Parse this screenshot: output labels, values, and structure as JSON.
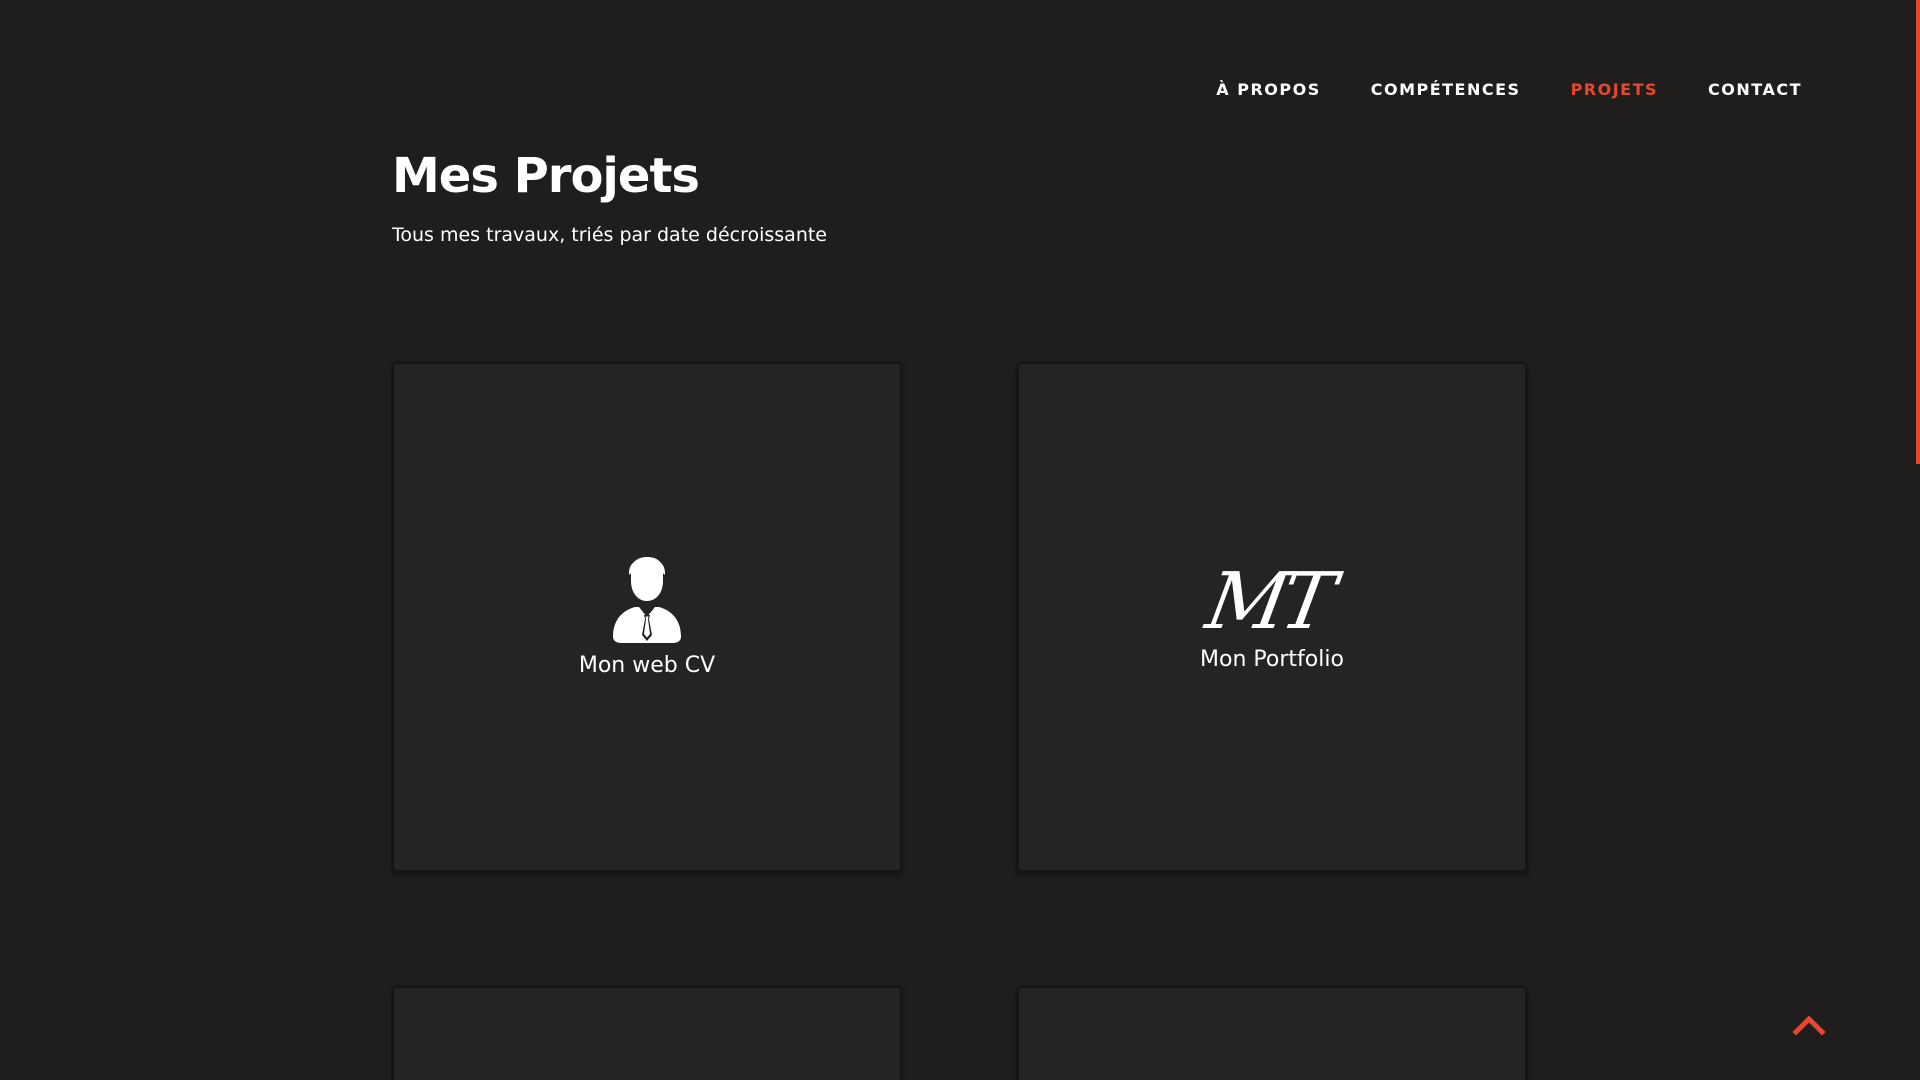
{
  "nav": {
    "items": [
      {
        "label": "À PROPOS"
      },
      {
        "label": "COMPÉTENCES"
      },
      {
        "label": "PROJETS",
        "active": true
      },
      {
        "label": "CONTACT"
      }
    ]
  },
  "header": {
    "title": "Mes Projets",
    "subtitle": "Tous mes travaux, triés par date décroissante"
  },
  "projects": [
    {
      "label": "Mon web CV",
      "icon": "businessman-icon"
    },
    {
      "label": "Mon Portfolio",
      "logo_text": "MT"
    }
  ],
  "colors": {
    "background": "#1f1e1d",
    "card": "#242427",
    "accent": "#e8472d",
    "text": "#ffffff"
  },
  "scroll_to_top": {
    "icon": "chevron-up-icon"
  }
}
